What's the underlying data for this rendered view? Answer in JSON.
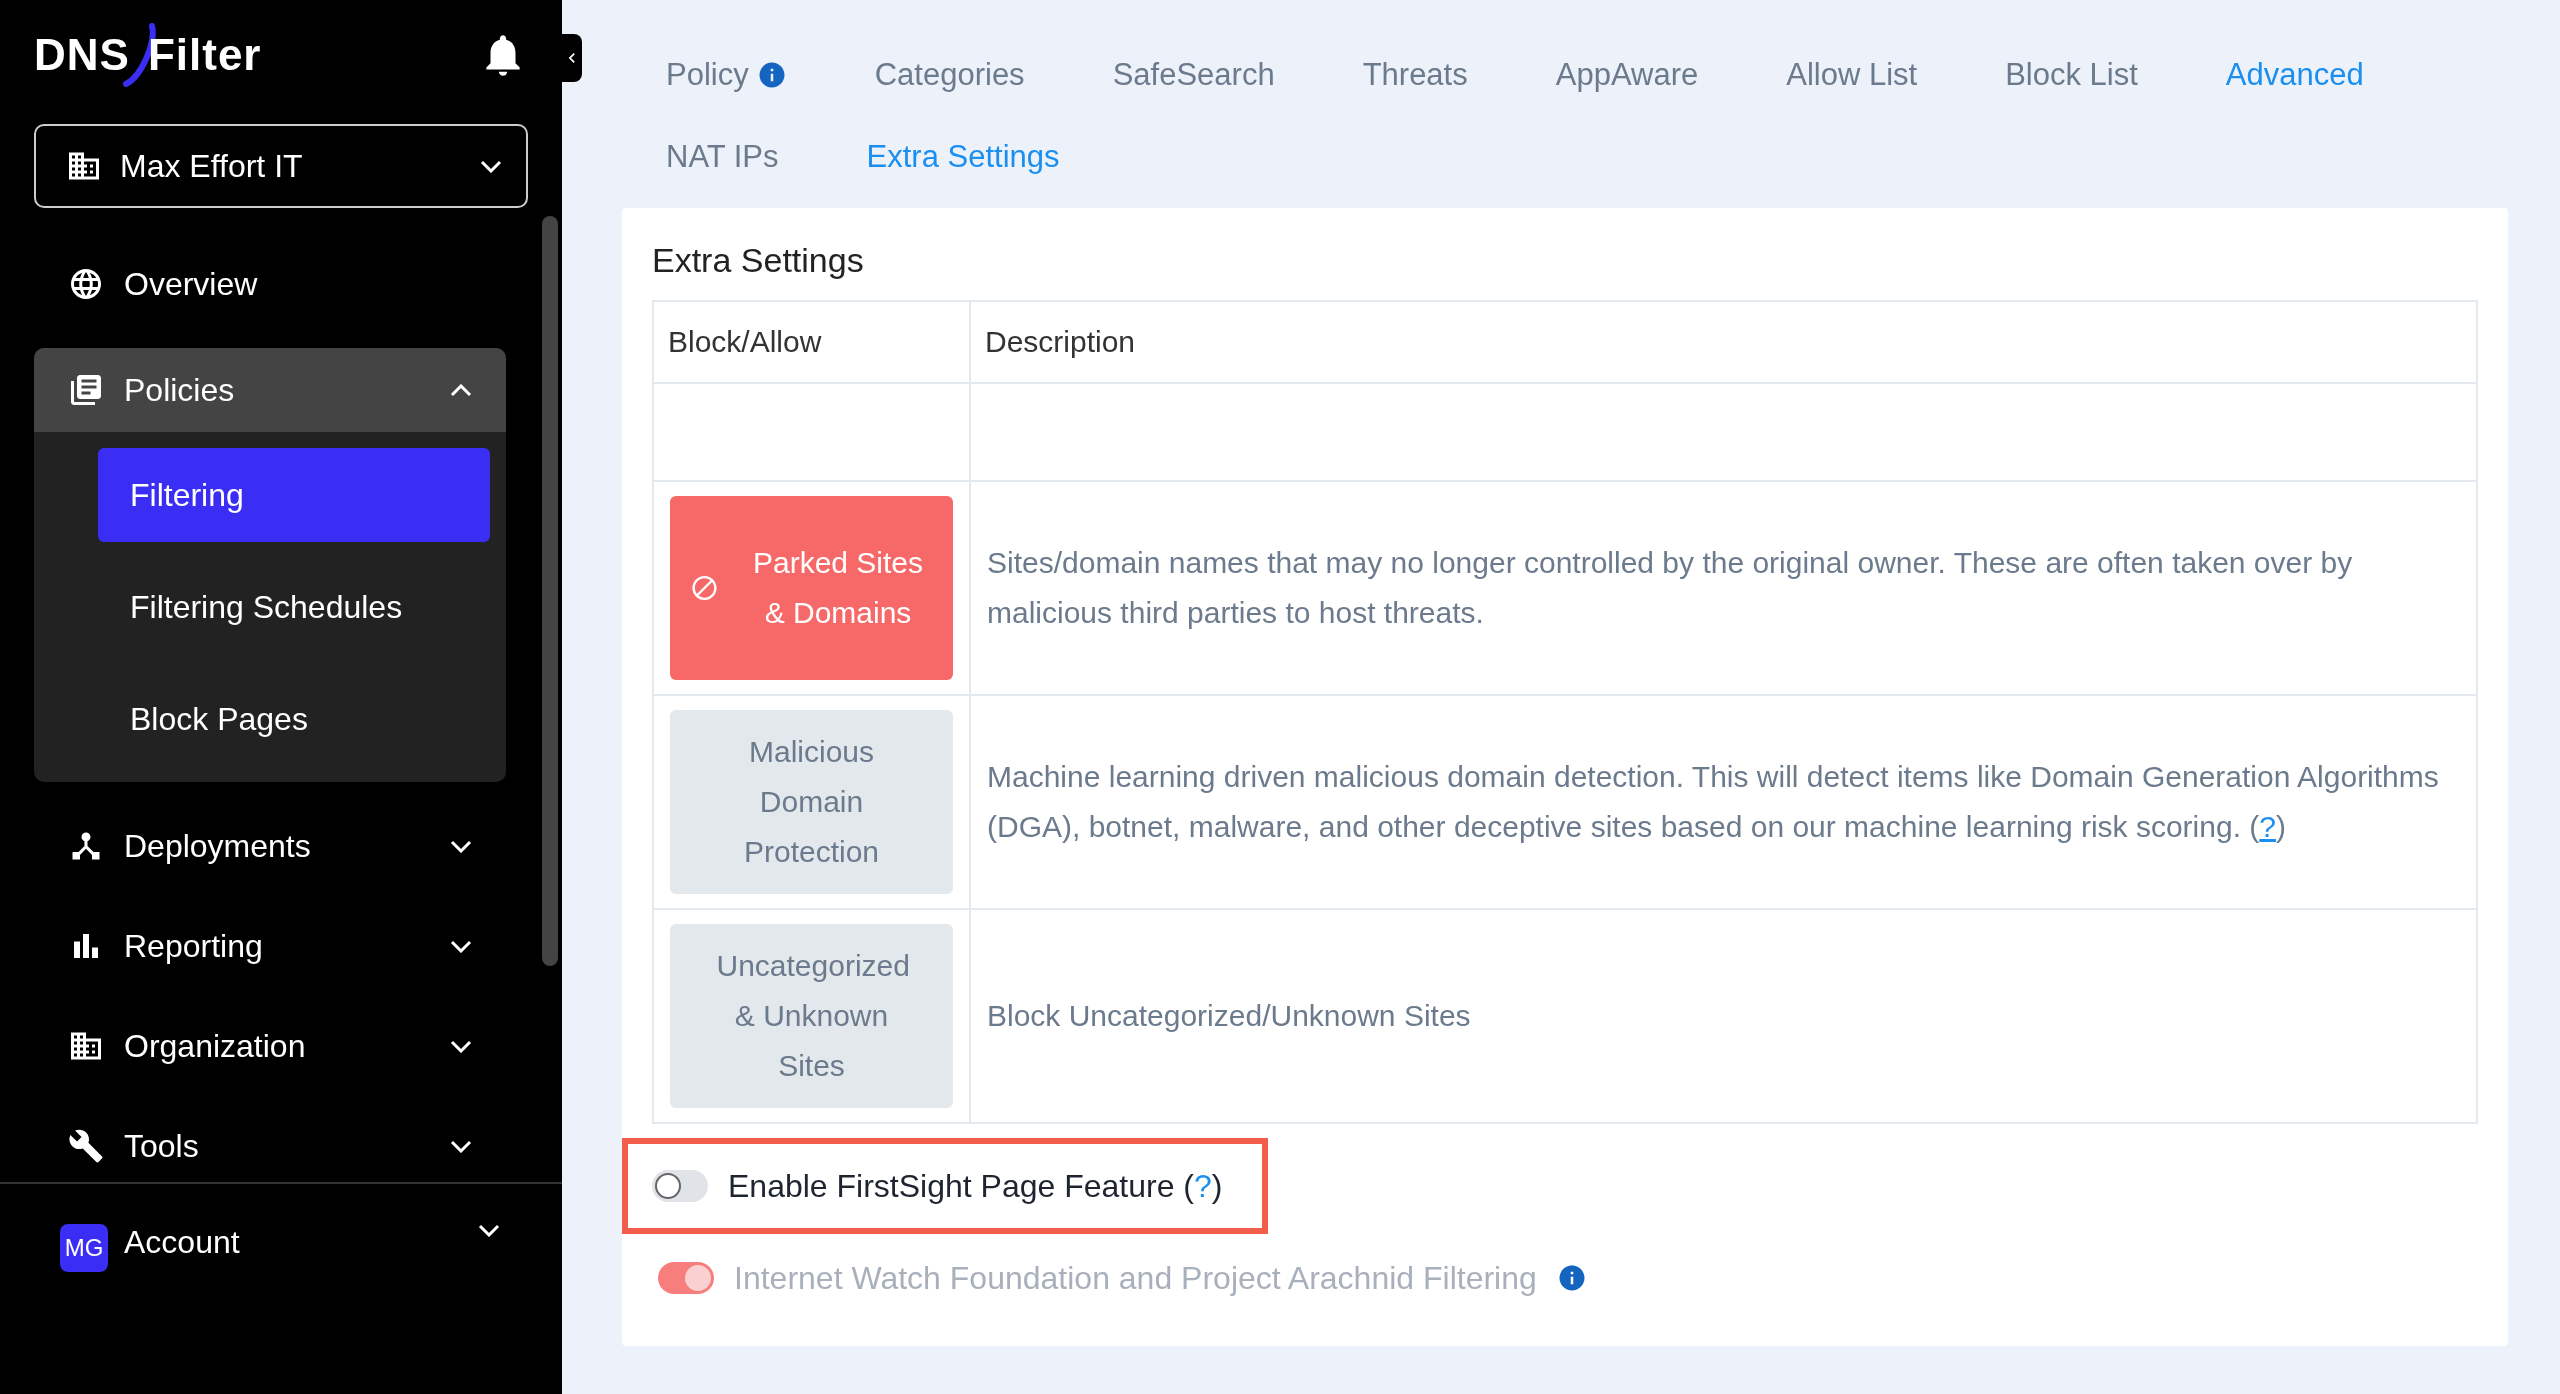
{
  "sidebar": {
    "logo": {
      "left": "DNS",
      "right": "Filter"
    },
    "organization": "Max Effort IT",
    "items": [
      {
        "label": "Overview"
      },
      {
        "label": "Policies",
        "expanded": true,
        "children": [
          {
            "label": "Filtering",
            "selected": true
          },
          {
            "label": "Filtering Schedules",
            "selected": false
          },
          {
            "label": "Block Pages",
            "selected": false
          }
        ]
      },
      {
        "label": "Deployments",
        "expanded": false
      },
      {
        "label": "Reporting",
        "expanded": false
      },
      {
        "label": "Organization",
        "expanded": false
      },
      {
        "label": "Tools",
        "expanded": false
      }
    ],
    "account": {
      "initials": "MG",
      "label": "Account",
      "expanded": false
    }
  },
  "tabs": [
    {
      "label": "Policy",
      "info": true,
      "selected": false
    },
    {
      "label": "Categories",
      "selected": false
    },
    {
      "label": "SafeSearch",
      "selected": false
    },
    {
      "label": "Threats",
      "selected": false
    },
    {
      "label": "AppAware",
      "selected": false
    },
    {
      "label": "Allow List",
      "selected": false
    },
    {
      "label": "Block List",
      "selected": false
    },
    {
      "label": "Advanced",
      "selected": true
    },
    {
      "label": "NAT IPs",
      "selected": false
    },
    {
      "label": "Extra Settings",
      "selected": true
    }
  ],
  "panel": {
    "title": "Extra Settings",
    "table": {
      "columns": [
        "Block/Allow",
        "Description"
      ],
      "rows": [
        {
          "label": "Parked Sites & Domains",
          "blocked": true,
          "description": "Sites/domain names that may no longer controlled by the original owner. These are often taken over by malicious third parties to host threats."
        },
        {
          "label": "Malicious Domain Protection",
          "blocked": false,
          "description": "Machine learning driven malicious domain detection. This will detect items like Domain Generation Algorithms (DGA), botnet, malware, and other deceptive sites based on our machine learning risk scoring. (",
          "link": "?",
          "after": ")"
        },
        {
          "label": "Uncategorized & Unknown Sites",
          "blocked": false,
          "description": "Block Uncategorized/Unknown Sites"
        }
      ]
    },
    "toggles": [
      {
        "label": "Enable FirstSight Page Feature (",
        "link": "?",
        "after": ")",
        "on": false,
        "disabled": false,
        "highlighted": true
      },
      {
        "label": "Internet Watch Foundation and Project Arachnid Filtering",
        "info": true,
        "on": true,
        "disabled": true,
        "highlighted": false
      }
    ]
  }
}
